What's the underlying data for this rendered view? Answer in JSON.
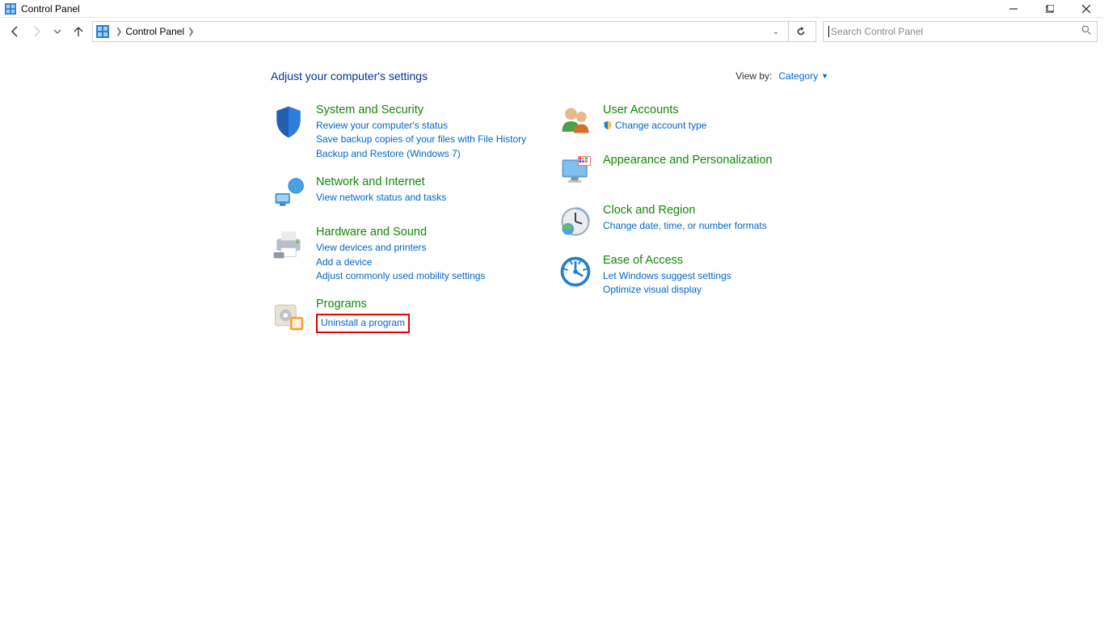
{
  "window": {
    "title": "Control Panel"
  },
  "breadcrumb": {
    "root": "Control Panel"
  },
  "search": {
    "placeholder": "Search Control Panel"
  },
  "header": {
    "title": "Adjust your computer's settings",
    "viewby_label": "View by:",
    "viewby_value": "Category"
  },
  "left_col": [
    {
      "title": "System and Security",
      "icon": "shield",
      "links": [
        {
          "text": "Review your computer's status"
        },
        {
          "text": "Save backup copies of your files with File History"
        },
        {
          "text": "Backup and Restore (Windows 7)"
        }
      ]
    },
    {
      "title": "Network and Internet",
      "icon": "network",
      "links": [
        {
          "text": "View network status and tasks"
        }
      ]
    },
    {
      "title": "Hardware and Sound",
      "icon": "printer",
      "links": [
        {
          "text": "View devices and printers"
        },
        {
          "text": "Add a device"
        },
        {
          "text": "Adjust commonly used mobility settings"
        }
      ]
    },
    {
      "title": "Programs",
      "icon": "programs",
      "links": [
        {
          "text": "Uninstall a program",
          "highlighted": true
        }
      ]
    }
  ],
  "right_col": [
    {
      "title": "User Accounts",
      "icon": "users",
      "links": [
        {
          "text": "Change account type",
          "shield": true
        }
      ]
    },
    {
      "title": "Appearance and Personalization",
      "icon": "appearance",
      "links": []
    },
    {
      "title": "Clock and Region",
      "icon": "clock",
      "links": [
        {
          "text": "Change date, time, or number formats"
        }
      ]
    },
    {
      "title": "Ease of Access",
      "icon": "ease",
      "links": [
        {
          "text": "Let Windows suggest settings"
        },
        {
          "text": "Optimize visual display"
        }
      ]
    }
  ]
}
